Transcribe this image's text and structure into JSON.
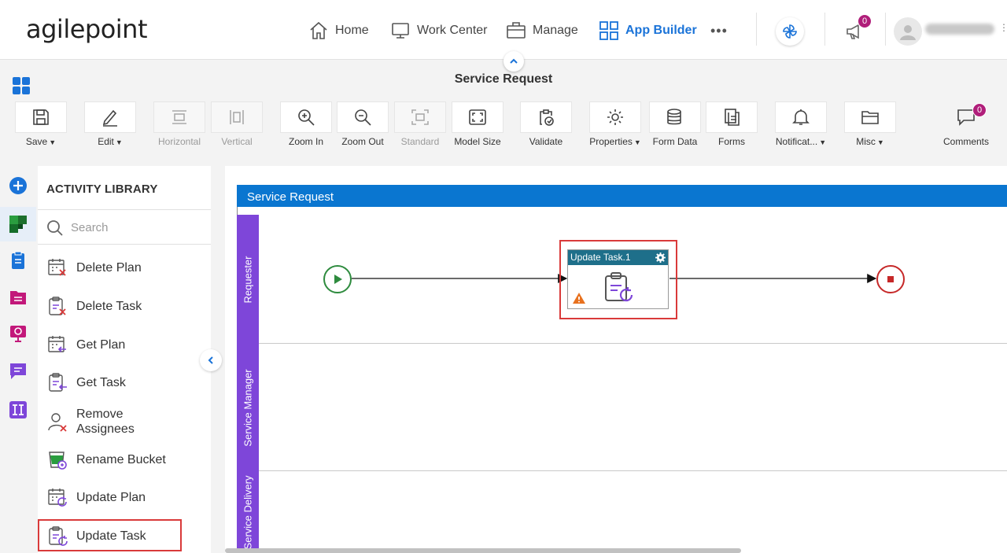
{
  "header": {
    "logo": "agilepoint",
    "nav": [
      {
        "label": "Home",
        "icon": "home-icon"
      },
      {
        "label": "Work Center",
        "icon": "monitor-icon"
      },
      {
        "label": "Manage",
        "icon": "briefcase-icon"
      },
      {
        "label": "App Builder",
        "icon": "app-grid-icon",
        "active": true
      },
      {
        "label": "•••",
        "icon": "more-icon"
      }
    ],
    "notifications_count": "0"
  },
  "page": {
    "title": "Service Request"
  },
  "toolbar": {
    "save": "Save",
    "edit": "Edit",
    "horizontal": "Horizontal",
    "vertical": "Vertical",
    "zoom_in": "Zoom In",
    "zoom_out": "Zoom Out",
    "standard": "Standard",
    "model_size": "Model Size",
    "validate": "Validate",
    "properties": "Properties",
    "form_data": "Form Data",
    "forms": "Forms",
    "notifications": "Notificat...",
    "misc": "Misc",
    "comments": "Comments",
    "comments_count": "0"
  },
  "library": {
    "title": "ACTIVITY LIBRARY",
    "search_placeholder": "Search",
    "items": [
      {
        "label": "Delete Plan"
      },
      {
        "label": "Delete Task"
      },
      {
        "label": "Get Plan"
      },
      {
        "label": "Get Task"
      },
      {
        "label": "Remove Assignees"
      },
      {
        "label": "Rename Bucket"
      },
      {
        "label": "Update Plan"
      },
      {
        "label": "Update Task",
        "highlighted": true
      }
    ]
  },
  "canvas": {
    "pool_title": "Service Request",
    "lanes": [
      "Requester",
      "Service Manager",
      "Service Delivery"
    ],
    "task": {
      "title": "Update Task.1",
      "warning": true
    }
  },
  "colors": {
    "accent": "#1a73d8",
    "lane": "#7e46d9",
    "pool_header": "#0a76d0",
    "task_header": "#1e6f8a",
    "start": "#2e8b3e",
    "end": "#c62828",
    "highlight": "#d93a3a",
    "badge": "#b01e7a"
  }
}
